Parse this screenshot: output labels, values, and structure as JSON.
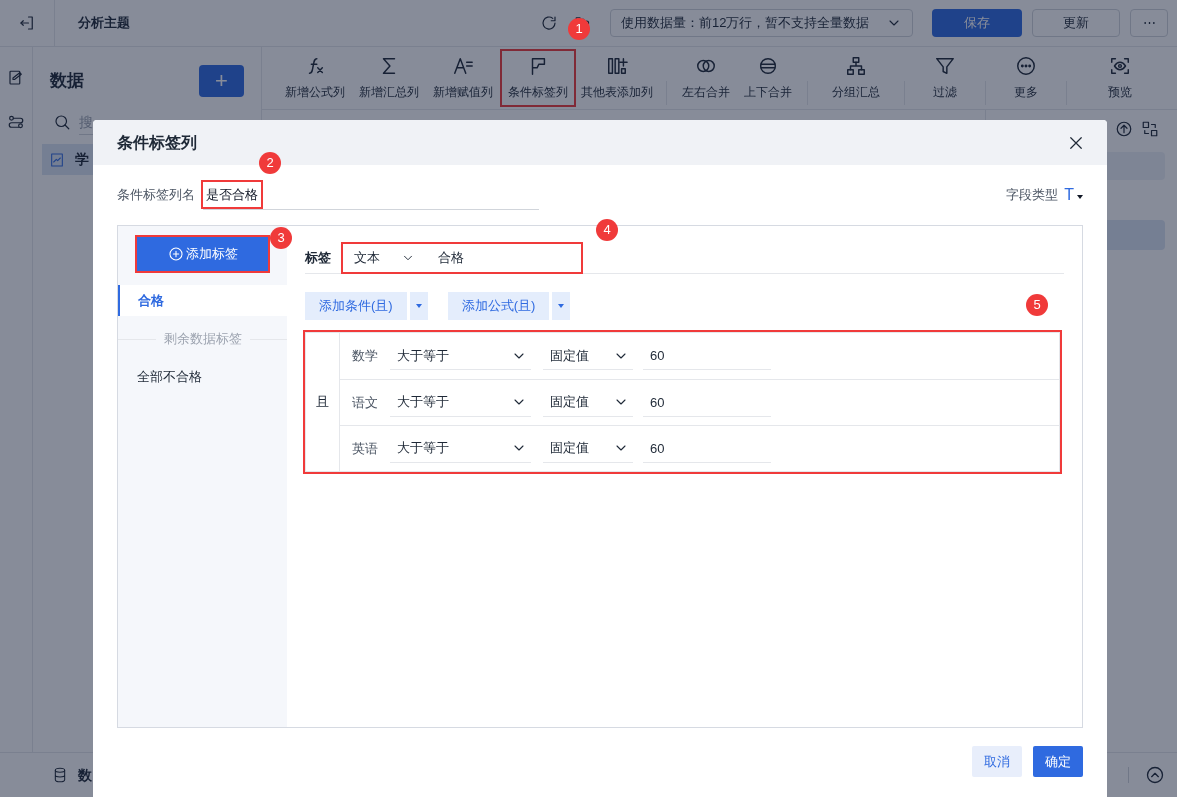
{
  "topbar": {
    "title": "分析主题",
    "data_limit": "使用数据量：前12万行，暂不支持全量数据",
    "buttons": [
      "保存",
      "更新"
    ],
    "more": "⋯"
  },
  "data_panel": {
    "title": "数据",
    "add": "+",
    "search_placeholder": "搜",
    "items": [
      {
        "label": "学",
        "selected": true
      }
    ],
    "footer": "数"
  },
  "toolbar": [
    {
      "label": "新增公式列",
      "highlighted": false
    },
    {
      "label": "新增汇总列",
      "highlighted": false
    },
    {
      "label": "新增赋值列",
      "highlighted": false
    },
    {
      "label": "条件标签列",
      "highlighted": true,
      "marker": "1"
    },
    {
      "label": "其他表添加列",
      "highlighted": false
    },
    {
      "label": "左右合并",
      "highlighted": false
    },
    {
      "label": "上下合并",
      "highlighted": false
    },
    {
      "label": "分组汇总",
      "highlighted": false
    },
    {
      "label": "过滤",
      "highlighted": false
    },
    {
      "label": "更多",
      "highlighted": false
    },
    {
      "label": "预览",
      "highlighted": false
    }
  ],
  "dialog": {
    "title": "条件标签列",
    "name_label": "条件标签列名",
    "name_value": "是否合格",
    "name_highlighted": true,
    "name_marker": "2",
    "field_type_label": "字段类型",
    "field_type_icon": "T",
    "add_tag": {
      "label": "添加标签",
      "highlighted": true,
      "marker": "3"
    },
    "tags": [
      {
        "label": "合格",
        "selected": true
      }
    ],
    "rest_divider": "剩余数据标签",
    "rest_tag": "全部不合格",
    "tag_row": {
      "label": "标签",
      "type": "文本",
      "value": "合格",
      "highlighted": true,
      "marker": "4"
    },
    "add_buttons": [
      "添加条件(且)",
      "添加公式(且)"
    ],
    "conditions": {
      "joiner": "且",
      "highlighted": true,
      "marker": "5",
      "rows": [
        {
          "field": "数学",
          "operator": "大于等于",
          "value_type": "固定值",
          "value": "60"
        },
        {
          "field": "语文",
          "operator": "大于等于",
          "value_type": "固定值",
          "value": "60"
        },
        {
          "field": "英语",
          "operator": "大于等于",
          "value_type": "固定值",
          "value": "60"
        }
      ]
    },
    "buttons": [
      "取消",
      "确定"
    ]
  }
}
